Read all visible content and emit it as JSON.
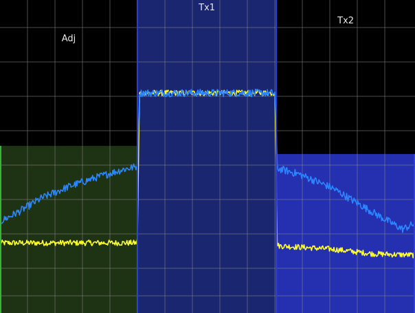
{
  "chart_data": {
    "type": "line",
    "title": "",
    "xlabel": "",
    "ylabel": "",
    "grid": true,
    "xlim": [
      0,
      100
    ],
    "ylim": [
      0,
      100
    ],
    "x_gridlines": [
      6.62,
      13.25,
      19.87,
      26.49,
      33.11,
      39.74,
      46.36,
      52.98,
      59.6,
      66.23,
      72.85,
      79.47,
      86.09,
      92.72
    ],
    "y_gridlines": [
      5.49,
      14.29,
      25.27,
      36.26,
      47.25,
      58.24,
      69.23,
      80.22,
      91.21
    ],
    "channels": [
      {
        "label": "Adj",
        "x_start": 0,
        "x_end": 33.1,
        "level": 53.4,
        "fill": "#1e3214",
        "edge": "#39b339"
      },
      {
        "label": "Tx1",
        "x_start": 33.1,
        "x_end": 66.6,
        "level": 100,
        "fill": "#1a2670",
        "edge": "#2f3fd6"
      },
      {
        "label": "Tx2",
        "x_start": 66.6,
        "x_end": 100,
        "level": 50.8,
        "fill": "#2530b0",
        "edge": "#2f3fd6"
      }
    ],
    "series": [
      {
        "color": "#ffff2a",
        "points": [
          [
            0,
            22.4
          ],
          [
            33.1,
            22.4
          ],
          [
            33.6,
            70.3
          ],
          [
            66.3,
            70.3
          ],
          [
            66.8,
            21.5
          ],
          [
            80,
            20.4
          ],
          [
            90,
            18.9
          ],
          [
            100,
            18.5
          ]
        ]
      },
      {
        "color": "#2a86ff",
        "points": [
          [
            0,
            29.2
          ],
          [
            5,
            32.7
          ],
          [
            10,
            36.7
          ],
          [
            16.6,
            40.4
          ],
          [
            23.2,
            43.3
          ],
          [
            29.8,
            45.9
          ],
          [
            33.1,
            46.8
          ],
          [
            33.6,
            70.3
          ],
          [
            66.3,
            70.3
          ],
          [
            66.8,
            46.2
          ],
          [
            72,
            44.4
          ],
          [
            80,
            40
          ],
          [
            86,
            35.2
          ],
          [
            92,
            30.5
          ],
          [
            97,
            26.8
          ],
          [
            100,
            28.6
          ]
        ]
      }
    ]
  }
}
